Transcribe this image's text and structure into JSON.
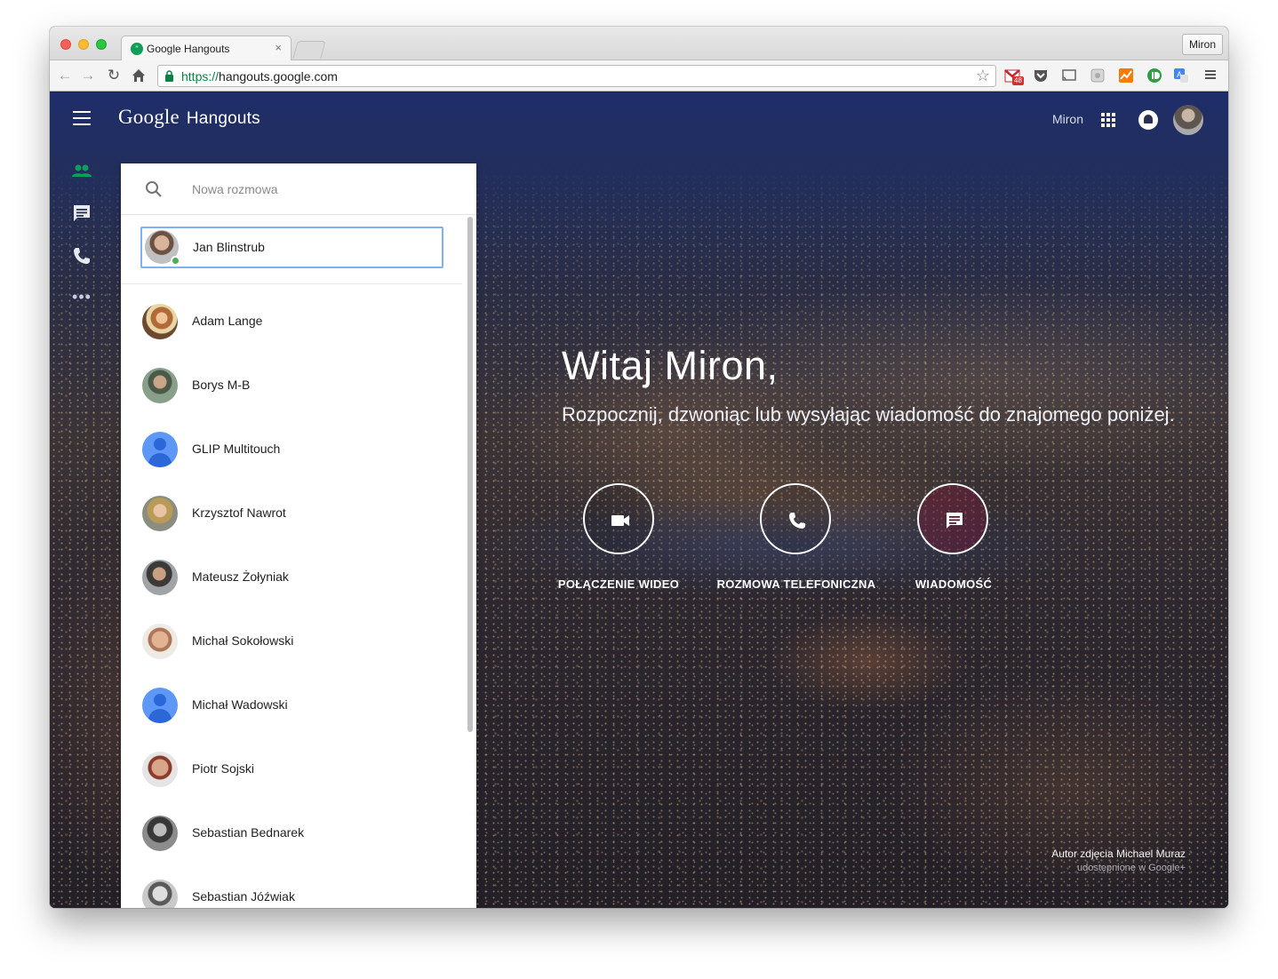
{
  "browser": {
    "tab_title": "Google Hangouts",
    "tab_close": "×",
    "profile_name": "Miron",
    "url_scheme": "https://",
    "url_host": "hangouts.google.com",
    "gmail_badge": "48"
  },
  "header": {
    "logo_google": "Google",
    "logo_product": "Hangouts",
    "user_name": "Miron"
  },
  "rail": {
    "more": "•••"
  },
  "contacts_panel": {
    "search_placeholder": "Nowa rozmowa",
    "pinned": {
      "name": "Jan Blinstrub",
      "online": true
    },
    "contacts": [
      {
        "name": "Adam Lange",
        "avatar": "photo"
      },
      {
        "name": "Borys M-B",
        "avatar": "photo"
      },
      {
        "name": "GLIP Multitouch",
        "avatar": "default"
      },
      {
        "name": "Krzysztof Nawrot",
        "avatar": "photo"
      },
      {
        "name": "Mateusz Żołyniak",
        "avatar": "photo"
      },
      {
        "name": "Michał Sokołowski",
        "avatar": "photo"
      },
      {
        "name": "Michał Wadowski",
        "avatar": "default"
      },
      {
        "name": "Piotr Sojski",
        "avatar": "photo"
      },
      {
        "name": "Sebastian Bednarek",
        "avatar": "photo"
      },
      {
        "name": "Sebastian Jóźwiak",
        "avatar": "photo"
      }
    ]
  },
  "welcome": {
    "title": "Witaj Miron,",
    "subtitle": "Rozpocznij, dzwoniąc lub wysyłając wiadomość do znajomego poniżej.",
    "actions": {
      "video": "POŁĄCZENIE WIDEO",
      "phone": "ROZMOWA TELEFONICZNA",
      "message": "WIADOMOŚĆ"
    }
  },
  "photo_credit": {
    "author": "Autor zdjęcia Michael Muraz",
    "shared": "udostępnione w Google+"
  },
  "colors": {
    "accent_green": "#0f9d58",
    "focus_blue": "#7fb1f3",
    "avatar_default": "#5e97f6",
    "online": "#4caf50"
  }
}
